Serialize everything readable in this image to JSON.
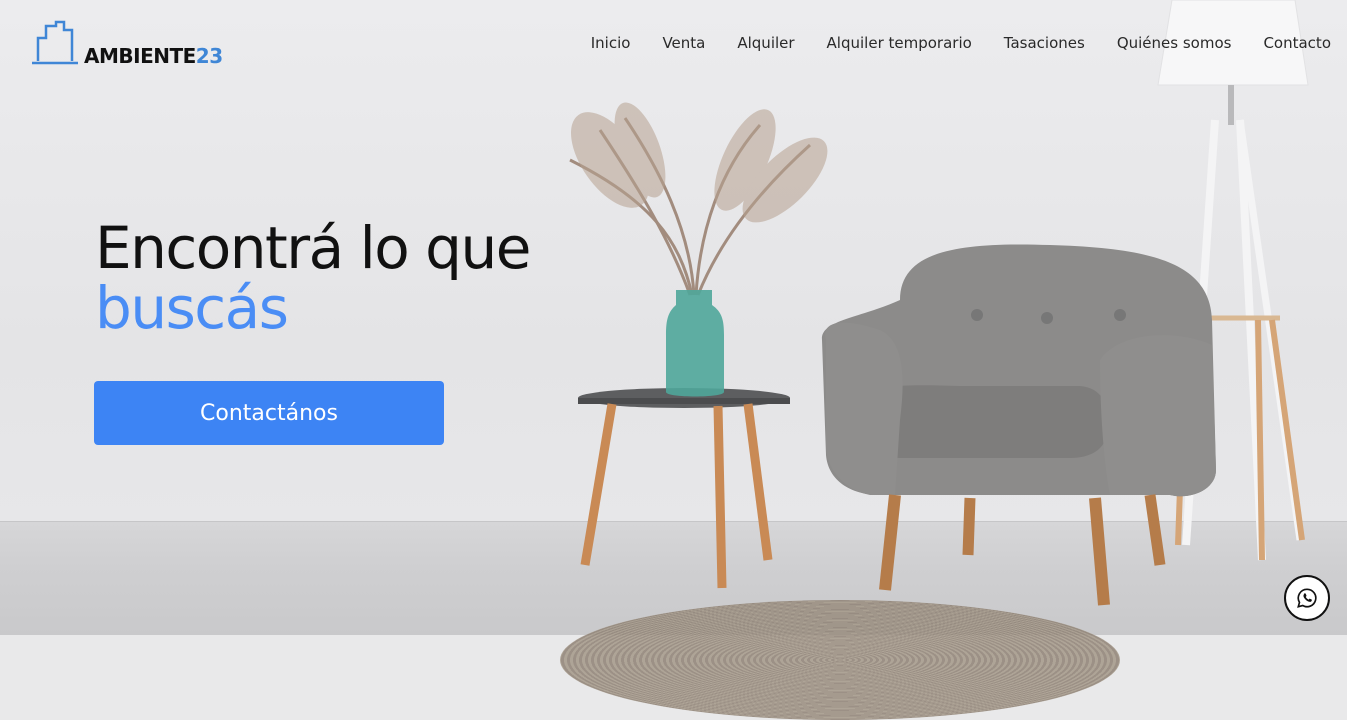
{
  "brand": {
    "name": "AMBIENTE",
    "number": "23"
  },
  "nav": {
    "items": [
      {
        "label": "Inicio"
      },
      {
        "label": "Venta"
      },
      {
        "label": "Alquiler"
      },
      {
        "label": "Alquiler temporario"
      },
      {
        "label": "Tasaciones"
      },
      {
        "label": "Quiénes somos"
      },
      {
        "label": "Contacto"
      }
    ]
  },
  "hero": {
    "line1": "Encontrá lo que",
    "line2": "buscás",
    "cta_label": "Contactános"
  },
  "icons": {
    "whatsapp": "whatsapp-icon",
    "logo": "building-icon"
  },
  "colors": {
    "accent": "#3d84f4",
    "headline_accent": "#4a8df5",
    "logo_accent": "#3f86d6"
  }
}
